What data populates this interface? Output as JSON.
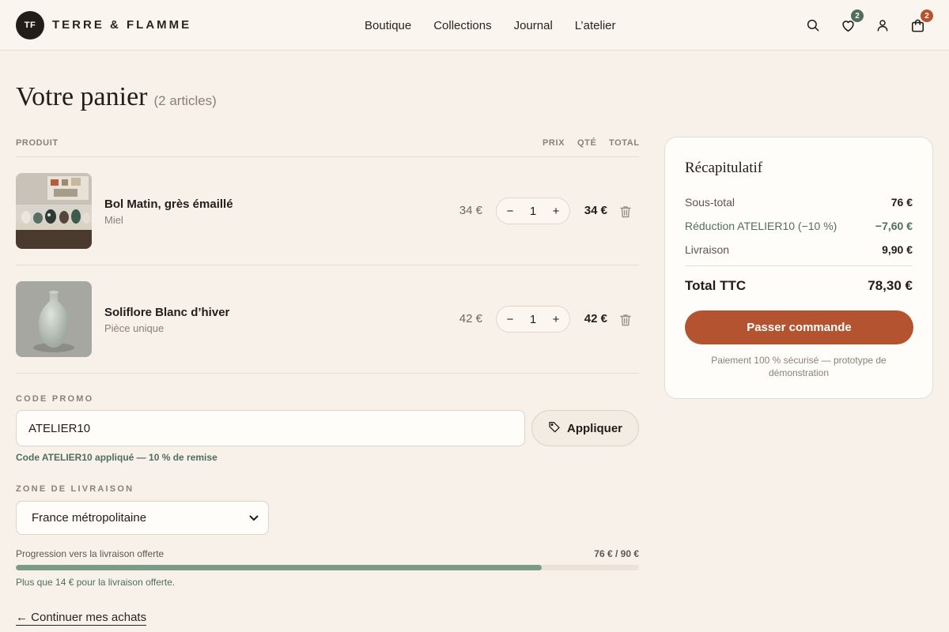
{
  "header": {
    "logo_initials": "TF",
    "brand": "TERRE & FLAMME",
    "nav": [
      "Boutique",
      "Collections",
      "Journal",
      "L’atelier"
    ],
    "wishlist_count": "2",
    "cart_count": "2"
  },
  "page": {
    "title": "Votre panier",
    "count": "(2 articles)"
  },
  "table": {
    "col_product": "PRODUIT",
    "col_price": "PRIX",
    "col_qty": "QTÉ",
    "col_total": "TOTAL"
  },
  "items": [
    {
      "name": "Bol Matin, grès émaillé",
      "variant": "Miel",
      "price": "34 €",
      "qty": "1",
      "total": "34 €"
    },
    {
      "name": "Soliflore Blanc d’hiver",
      "variant": "Pièce unique",
      "price": "42 €",
      "qty": "1",
      "total": "42 €"
    }
  ],
  "promo": {
    "label": "CODE PROMO",
    "value": "ATELIER10",
    "apply_label": "Appliquer",
    "success": "Code ATELIER10 appliqué — 10 % de remise"
  },
  "zone": {
    "label": "ZONE DE LIVRAISON",
    "selected": "France métropolitaine"
  },
  "progress": {
    "label": "Progression vers la livraison offerte",
    "value_text": "76 € / 90 €",
    "fraction": 0.844,
    "note": "Plus que 14 € pour la livraison offerte."
  },
  "continue_label": "← Continuer mes achats",
  "summary": {
    "title": "Récapitulatif",
    "subtotal_label": "Sous-total",
    "subtotal": "76 €",
    "discount_label": "Réduction ATELIER10 (−10 %)",
    "discount": "−7,60 €",
    "shipping_label": "Livraison",
    "shipping": "9,90 €",
    "total_label": "Total TTC",
    "total": "78,30 €",
    "checkout_label": "Passer commande",
    "secure_note": "Paiement 100 % sécurisé — prototype de démonstration"
  },
  "colors": {
    "accent": "#b4532f",
    "success": "#4f6f5c",
    "background": "#f7f1ea"
  }
}
